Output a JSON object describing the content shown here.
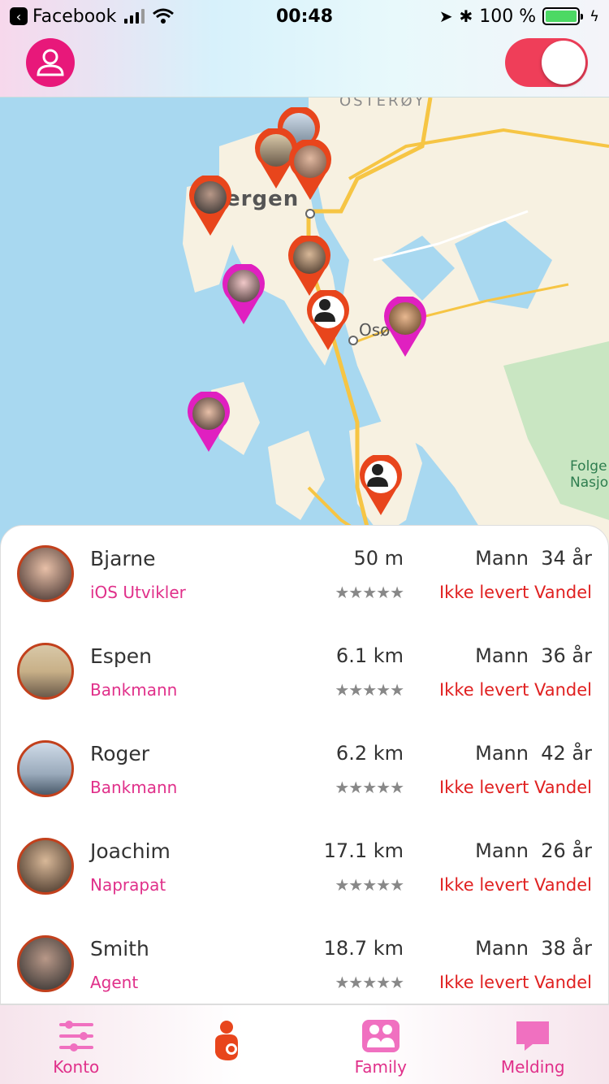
{
  "status_bar": {
    "back_app": "Facebook",
    "time": "00:48",
    "battery": "100 %"
  },
  "map": {
    "labels": {
      "bergen": "ergen",
      "osteroy": "OSTERØY",
      "os": "Osø",
      "folge": "Folge\nNasjo"
    }
  },
  "people": [
    {
      "name": "Bjarne",
      "job": "iOS Utvikler",
      "distance": "50 m",
      "rating": "★★★★★",
      "gender": "Mann",
      "age": "34 år",
      "status": "Ikke levert Vandel"
    },
    {
      "name": "Espen",
      "job": "Bankmann",
      "distance": "6.1 km",
      "rating": "★★★★★",
      "gender": "Mann",
      "age": "36 år",
      "status": "Ikke levert Vandel"
    },
    {
      "name": "Roger",
      "job": "Bankmann",
      "distance": "6.2 km",
      "rating": "★★★★★",
      "gender": "Mann",
      "age": "42 år",
      "status": "Ikke levert Vandel"
    },
    {
      "name": "Joachim",
      "job": "Naprapat",
      "distance": "17.1 km",
      "rating": "★★★★★",
      "gender": "Mann",
      "age": "26 år",
      "status": "Ikke levert Vandel"
    },
    {
      "name": "Smith",
      "job": "Agent",
      "distance": "18.7 km",
      "rating": "★★★★★",
      "gender": "Mann",
      "age": "38 år",
      "status": "Ikke levert Vandel"
    }
  ],
  "tabs": [
    {
      "label": "Konto",
      "icon": "sliders-icon"
    },
    {
      "label": "",
      "icon": "mother-child-icon"
    },
    {
      "label": "Family",
      "icon": "family-icon"
    },
    {
      "label": "Melding",
      "icon": "message-icon"
    }
  ],
  "colors": {
    "accent": "#e0308a",
    "toggle": "#ef3e59",
    "pin_male": "#e8451c",
    "pin_female": "#e020c0",
    "status_red": "#e02020"
  }
}
